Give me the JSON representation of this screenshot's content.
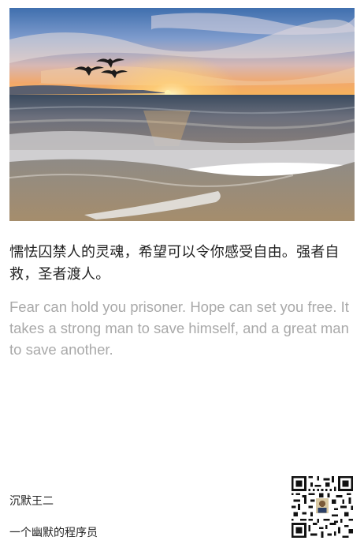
{
  "quote": {
    "chinese": "懦怯囚禁人的灵魂，希望可以令你感受自由。强者自救，圣者渡人。",
    "english": "Fear can hold you prisoner. Hope can set you free. It takes a strong man to save himself, and a great man to save another."
  },
  "footer": {
    "author": "沉默王二",
    "subtitle": "一个幽默的程序员"
  },
  "colors": {
    "english_text": "#a9a9a9",
    "main_text": "#222222"
  },
  "icons": {
    "qr": "qr-code-icon",
    "photo": "sunset-beach-photo"
  }
}
